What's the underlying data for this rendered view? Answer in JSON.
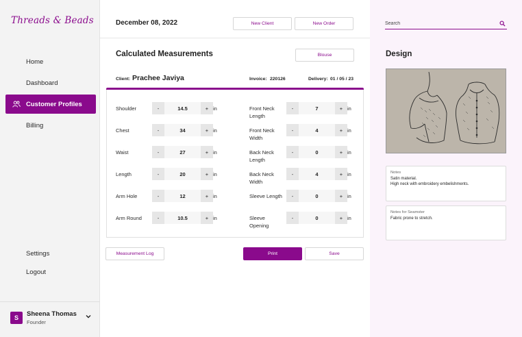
{
  "brand": {
    "logo_text": "Threads & Beads",
    "accent": "#8a0a8c"
  },
  "sidebar": {
    "items": [
      {
        "label": "Home",
        "icon": "home-icon"
      },
      {
        "label": "Dashboard",
        "icon": "dashboard-icon"
      },
      {
        "label": "Customer Profiles",
        "icon": "users-icon",
        "active": true
      },
      {
        "label": "Billing",
        "icon": "billing-icon"
      }
    ],
    "bottom_items": [
      {
        "label": "Settings"
      },
      {
        "label": "Logout"
      }
    ],
    "user": {
      "initial": "S",
      "name": "Sheena Thomas",
      "role": "Founder"
    }
  },
  "header": {
    "date": "December 08, 2022",
    "new_client_label": "New Client",
    "new_order_label": "New Order"
  },
  "main": {
    "title": "Calculated Measurements",
    "garment_button": "Blouse",
    "client_label": "Client:",
    "client_name": "Prachee Javiya",
    "invoice_label": "Invoice:",
    "invoice_value": "220126",
    "delivery_label": "Delivery:",
    "delivery_value": "01 / 05 / 23",
    "minus": "-",
    "plus": "+",
    "unit": "in",
    "left_measurements": [
      {
        "label": "Shoulder",
        "value": "14.5"
      },
      {
        "label": "Chest",
        "value": "34"
      },
      {
        "label": "Waist",
        "value": "27"
      },
      {
        "label": "Length",
        "value": "20"
      },
      {
        "label": "Arm Hole",
        "value": "12"
      },
      {
        "label": "Arm Round",
        "value": "10.5"
      }
    ],
    "right_measurements": [
      {
        "label": "Front Neck\nLength",
        "value": "7"
      },
      {
        "label": "Front Neck\nWidth",
        "value": "4"
      },
      {
        "label": "Back Neck\nLength",
        "value": "0"
      },
      {
        "label": "Back Neck\nWidth",
        "value": "4"
      },
      {
        "label": "Sleeve Length",
        "value": "0"
      },
      {
        "label": "Sleeve\nOpening",
        "value": "0"
      }
    ],
    "measurement_log_label": "Measurement Log",
    "print_label": "Print",
    "save_label": "Save"
  },
  "right_panel": {
    "search_placeholder": "Search",
    "design_title": "Design",
    "notes_label": "Notes",
    "notes_text": "Satin material.\nHigh neck with embroidery embelishments.",
    "seamster_label": "Notes for Seamster",
    "seamster_text": "Fabric prone to stretch."
  }
}
